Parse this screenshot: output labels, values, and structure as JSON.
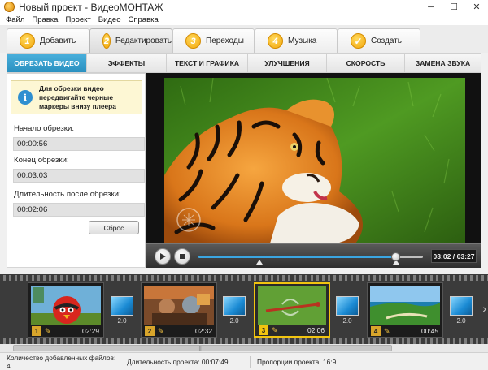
{
  "window": {
    "title": "Новый проект - ВидеоМОНТАЖ",
    "minimize": "─",
    "maximize": "☐",
    "close": "✕"
  },
  "menu": [
    "Файл",
    "Правка",
    "Проект",
    "Видео",
    "Справка"
  ],
  "main_tabs": [
    {
      "num": "1",
      "label": "Добавить",
      "active": false
    },
    {
      "num": "2",
      "label": "Редактировать",
      "active": true
    },
    {
      "num": "3",
      "label": "Переходы",
      "active": false
    },
    {
      "num": "4",
      "label": "Музыка",
      "active": false
    },
    {
      "num": "✓",
      "label": "Создать",
      "active": false
    }
  ],
  "sub_tabs": [
    {
      "label": "ОБРЕЗАТЬ ВИДЕО",
      "active": true
    },
    {
      "label": "ЭФФЕКТЫ",
      "active": false
    },
    {
      "label": "ТЕКСТ И ГРАФИКА",
      "active": false
    },
    {
      "label": "УЛУЧШЕНИЯ",
      "active": false
    },
    {
      "label": "СКОРОСТЬ",
      "active": false
    },
    {
      "label": "ЗАМЕНА ЗВУКА",
      "active": false
    }
  ],
  "trim_panel": {
    "info_icon": "i",
    "info_text": "Для обрезки видео передвигайте черные маркеры внизу плеера",
    "start_label": "Начало обрезки:",
    "start_value": "00:00:56",
    "end_label": "Конец обрезки:",
    "end_value": "00:03:03",
    "duration_label": "Длительность после обрезки:",
    "duration_value": "00:02:06",
    "reset_button": "Сброс"
  },
  "player": {
    "time": "03:02 / 03:27",
    "progress": 0.88,
    "trim_start": 0.27,
    "trim_end": 0.88
  },
  "clips": [
    {
      "num": "1",
      "duration": "02:29",
      "selected": false
    },
    {
      "num": "2",
      "duration": "02:32",
      "selected": false
    },
    {
      "num": "3",
      "duration": "02:06",
      "selected": true
    },
    {
      "num": "4",
      "duration": "00:45",
      "selected": false
    }
  ],
  "transitions": [
    "2.0",
    "2.0",
    "2.0",
    "2.0"
  ],
  "status": {
    "files": "Количество добавленных файлов: 4",
    "duration": "Длительность проекта:  00:07:49",
    "ratio": "Пропорции проекта:  16:9"
  },
  "icons": {
    "app": "app-icon",
    "play": "play-icon",
    "stop": "stop-icon",
    "edit": "pencil-icon",
    "scroll_right": "chevron-right-icon"
  },
  "colors": {
    "accent_blue": "#2a90c0",
    "tab_number": "#f3a70c",
    "selected_clip": "#f1c40f"
  }
}
